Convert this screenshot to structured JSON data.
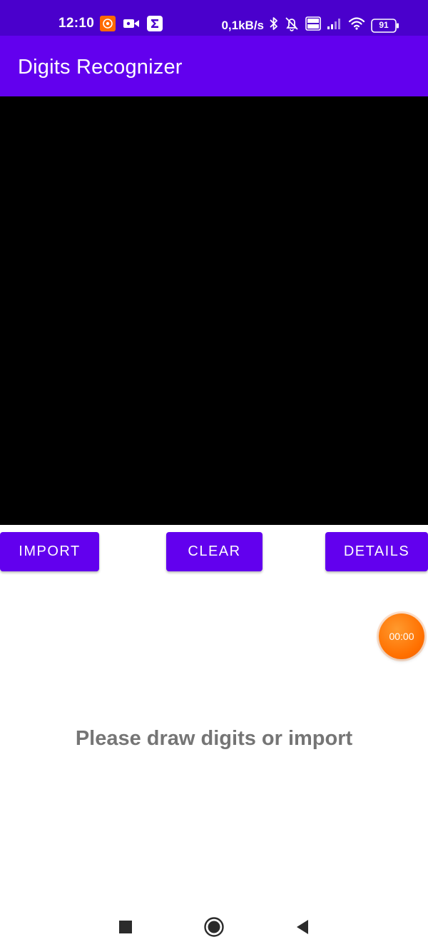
{
  "status_bar": {
    "time": "12:10",
    "net_speed": "0,1kB/s",
    "battery": "91",
    "icons_left": [
      "camera-app-icon",
      "video-record-icon",
      "sigma-app-icon"
    ],
    "icons_right": [
      "bluetooth-icon",
      "alarm-off-icon",
      "volte-icon",
      "signal-icon",
      "wifi-icon",
      "battery-icon"
    ]
  },
  "app_bar": {
    "title": "Digits Recognizer"
  },
  "buttons": {
    "import": "IMPORT",
    "clear": "CLEAR",
    "details": "DETAILS"
  },
  "timer": {
    "label": "00:00"
  },
  "result": {
    "prompt": "Please draw digits or import"
  },
  "nav_bar": {
    "icons": [
      "recents-square-icon",
      "home-circle-icon",
      "back-triangle-icon"
    ]
  },
  "colors": {
    "status_bar": "#4a00cc",
    "app_bar": "#6200ee",
    "button": "#6200ee",
    "canvas": "#000000",
    "prompt_text": "#757575",
    "timer": "#ff7a00"
  }
}
